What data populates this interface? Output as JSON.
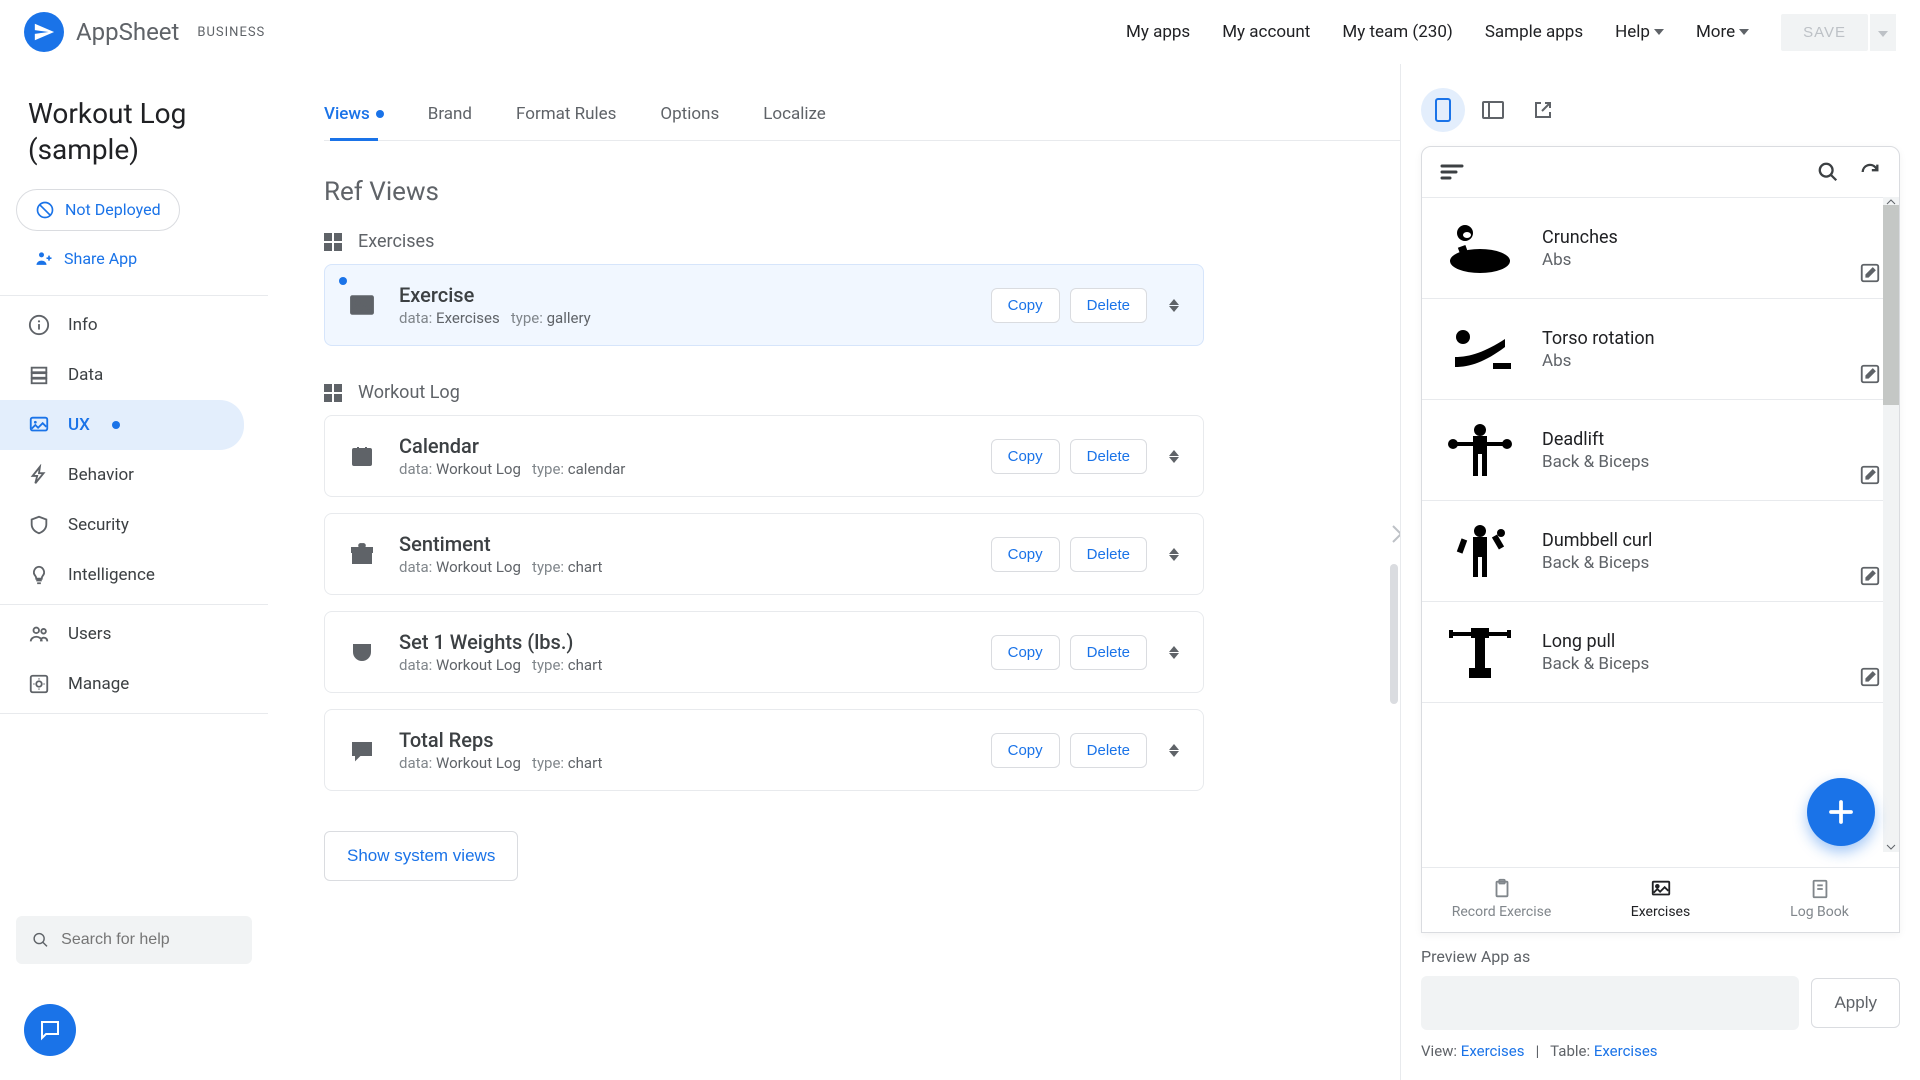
{
  "header": {
    "app_name": "AppSheet",
    "tag": "BUSINESS",
    "links": {
      "my_apps": "My apps",
      "my_account": "My account",
      "my_team": "My team (230)",
      "sample_apps": "Sample apps",
      "help": "Help",
      "more": "More"
    },
    "save": "SAVE"
  },
  "sidebar": {
    "title_line1": "Workout Log",
    "title_line2": "(sample)",
    "not_deployed": "Not Deployed",
    "share_app": "Share App",
    "nav": {
      "info": "Info",
      "data": "Data",
      "ux": "UX",
      "behavior": "Behavior",
      "security": "Security",
      "intelligence": "Intelligence",
      "users": "Users",
      "manage": "Manage"
    },
    "search_placeholder": "Search for help"
  },
  "main": {
    "tabs": {
      "views": "Views",
      "brand": "Brand",
      "format_rules": "Format Rules",
      "options": "Options",
      "localize": "Localize"
    },
    "section_title": "Ref Views",
    "group1": "Exercises",
    "group2": "Workout Log",
    "data_label": "data:",
    "type_label": "type:",
    "copy": "Copy",
    "delete": "Delete",
    "views_list": [
      {
        "group": 0,
        "title": "Exercise",
        "data": "Exercises",
        "type": "gallery",
        "icon": "image",
        "active": true
      },
      {
        "group": 1,
        "title": "Calendar",
        "data": "Workout Log",
        "type": "calendar",
        "icon": "calendar"
      },
      {
        "group": 1,
        "title": "Sentiment",
        "data": "Workout Log",
        "type": "chart",
        "icon": "gift"
      },
      {
        "group": 1,
        "title": "Set 1 Weights (lbs.)",
        "data": "Workout Log",
        "type": "chart",
        "icon": "pocket"
      },
      {
        "group": 1,
        "title": "Total Reps",
        "data": "Workout Log",
        "type": "chart",
        "icon": "message"
      }
    ],
    "show_system": "Show system views"
  },
  "preview": {
    "items": [
      {
        "title": "Crunches",
        "sub": "Abs"
      },
      {
        "title": "Torso rotation",
        "sub": "Abs"
      },
      {
        "title": "Deadlift",
        "sub": "Back & Biceps"
      },
      {
        "title": "Dumbbell curl",
        "sub": "Back & Biceps"
      },
      {
        "title": "Long pull",
        "sub": "Back & Biceps"
      }
    ],
    "tabs": {
      "record": "Record Exercise",
      "exercises": "Exercises",
      "logbook": "Log Book"
    },
    "footer_label": "Preview App as",
    "apply": "Apply",
    "view_label": "View:",
    "view_value": "Exercises",
    "sep": "|",
    "table_label": "Table:",
    "table_value": "Exercises"
  }
}
